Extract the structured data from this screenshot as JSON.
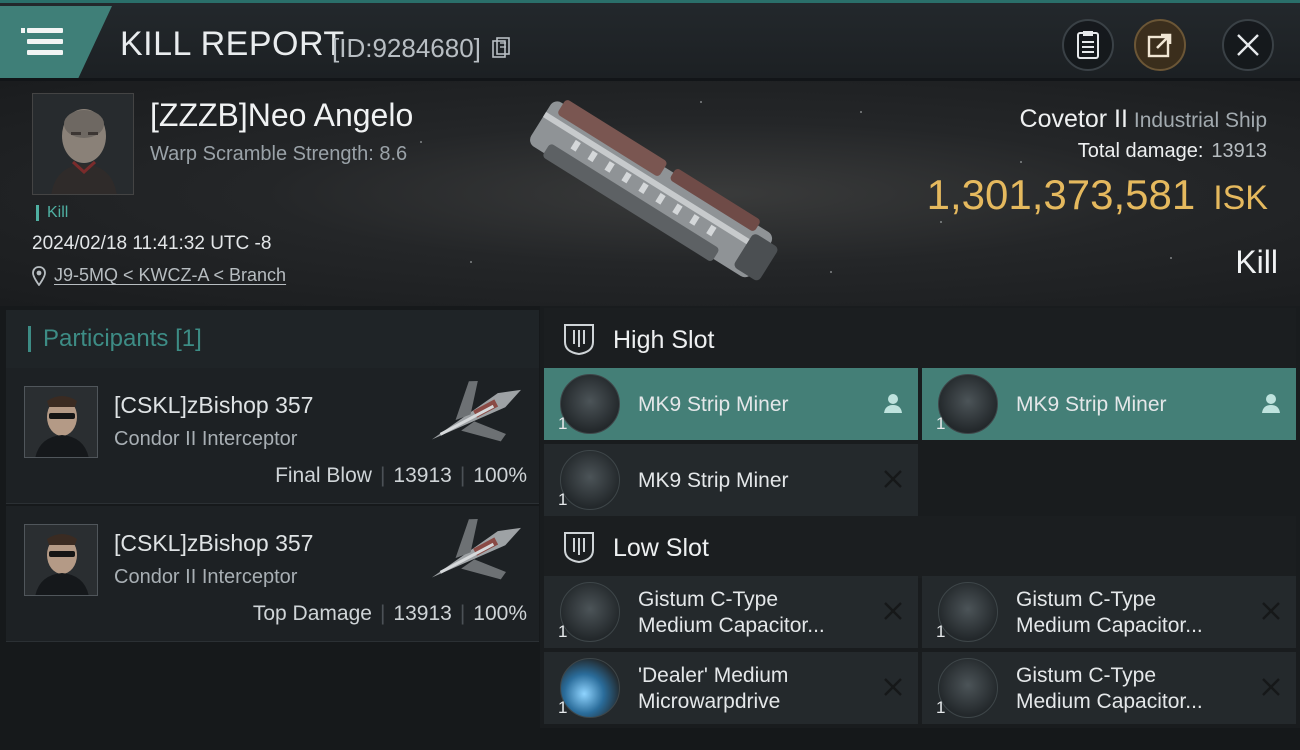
{
  "header": {
    "title": "KILL REPORT",
    "report_id": "[ID:9284680]"
  },
  "victim": {
    "name": "[ZZZB]Neo Angelo",
    "warp_scramble": "Warp Scramble Strength: 8.6",
    "tag": "Kill",
    "timestamp": "2024/02/18 11:41:32 UTC -8",
    "location": "J9-5MQ < KWCZ-A < Branch",
    "ship_name": "Covetor II",
    "ship_class": "Industrial Ship",
    "total_damage_label": "Total damage:",
    "total_damage": "13913",
    "isk_value": "1,301,373,581",
    "isk_unit": "ISK",
    "result": "Kill"
  },
  "participants": {
    "title": "Participants",
    "count": "[1]",
    "items": [
      {
        "name": "[CSKL]zBishop 357",
        "ship": "Condor II Interceptor",
        "role": "Final Blow",
        "damage": "13913",
        "percent": "100%"
      },
      {
        "name": "[CSKL]zBishop 357",
        "ship": "Condor II Interceptor",
        "role": "Top Damage",
        "damage": "13913",
        "percent": "100%"
      }
    ]
  },
  "slots": {
    "high": {
      "title": "High Slot",
      "items": [
        {
          "qty": "1",
          "name": "MK9 Strip Miner",
          "status": "person-icon"
        },
        {
          "qty": "1",
          "name": "MK9 Strip Miner",
          "status": "person-icon"
        },
        {
          "qty": "1",
          "name": "MK9 Strip Miner",
          "status": "close-icon"
        }
      ]
    },
    "low": {
      "title": "Low Slot",
      "items": [
        {
          "qty": "1",
          "line1": "Gistum C-Type",
          "line2": "Medium Capacitor...",
          "status": "close-icon"
        },
        {
          "qty": "1",
          "line1": "Gistum C-Type",
          "line2": "Medium Capacitor...",
          "status": "close-icon"
        },
        {
          "qty": "1",
          "line1": "'Dealer' Medium",
          "line2": "Microwarpdrive",
          "status": "close-icon"
        },
        {
          "qty": "1",
          "line1": "Gistum C-Type",
          "line2": "Medium Capacitor...",
          "status": "close-icon"
        }
      ]
    }
  },
  "colors": {
    "accent_teal": "#447f77",
    "isk_gold": "#e5b95e",
    "participants_teal": "#3d8c85"
  }
}
